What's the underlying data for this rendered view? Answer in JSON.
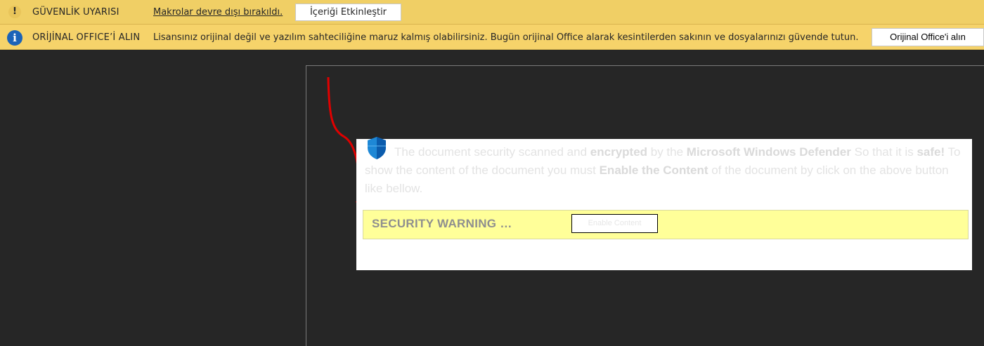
{
  "security_bar": {
    "icon": "exclamation-icon",
    "title": "GÜVENLİK UYARISI",
    "message": "Makrolar devre dışı bırakıldı.",
    "button": "İçeriği Etkinleştir",
    "color": "#f0cf65"
  },
  "license_bar": {
    "icon": "info-icon",
    "title": "ORİJİNAL OFFICE’İ ALIN",
    "message": "Lisansınız orijinal değil ve yazılım sahteciliğine maruz kalmış olabilirsiniz. Bugün orijinal Office alarak kesintilerden sakının ve dosyalarınızı güvende tutun.",
    "button": "Orijinal Office'i alın",
    "color": "#f6d36a"
  },
  "document": {
    "shield_icon": "shield-icon",
    "text_parts": [
      "The document security scanned and ",
      "encrypted",
      " by the ",
      "Microsoft Windows Defender",
      " So that it is ",
      "safe!",
      " To show the content of the document you must ",
      "Enable the Content",
      " of the document by click on the above button like bellow."
    ],
    "warning_title": "SECURITY WARNING …",
    "warning_button": "Enable Content",
    "warning_color": "#ffff99",
    "arrow_color": "#e00000"
  }
}
